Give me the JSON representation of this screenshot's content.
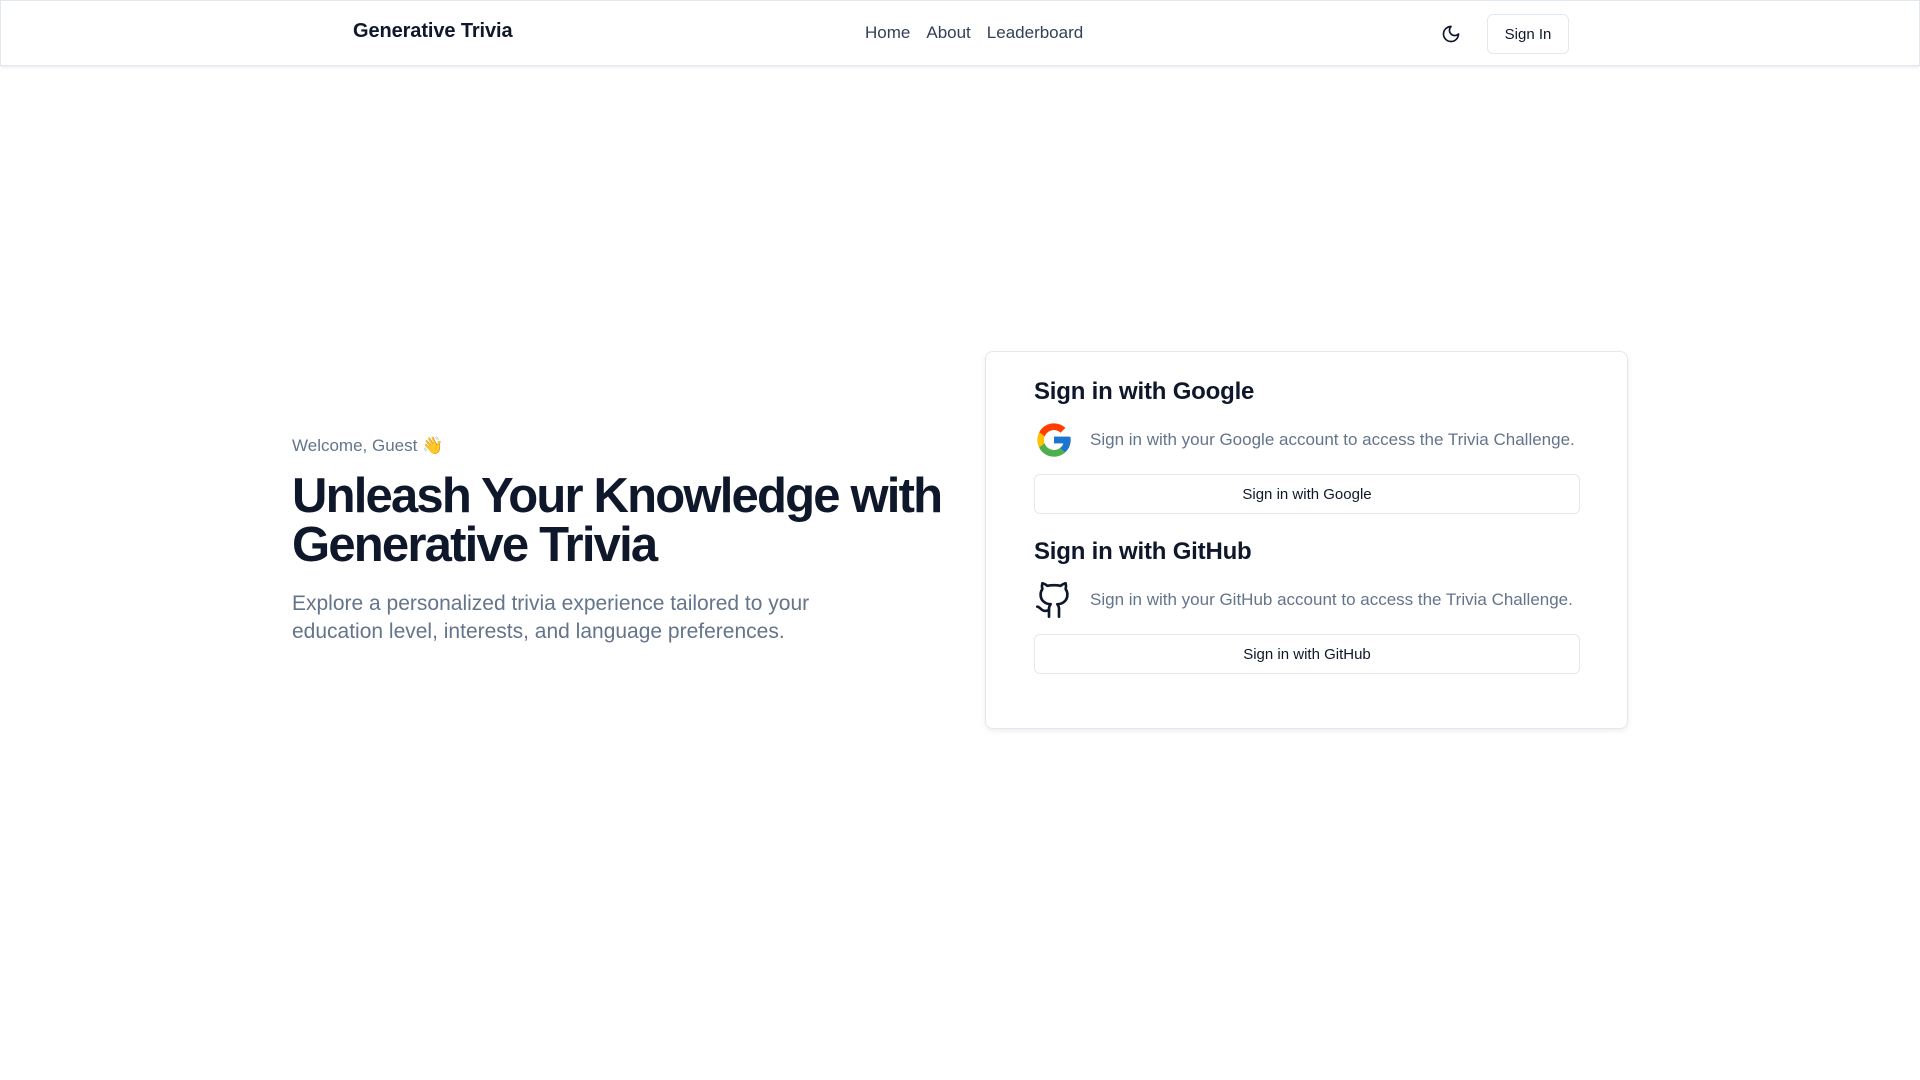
{
  "header": {
    "brand": "Generative Trivia",
    "nav": [
      "Home",
      "About",
      "Leaderboard"
    ],
    "theme_icon": "moon-icon",
    "sign_in_label": "Sign In"
  },
  "hero": {
    "welcome": "Welcome, Guest 👋",
    "headline_line1": "Unleash Your Knowledge with",
    "headline_line2": "Generative Trivia",
    "subtitle": "Explore a personalized trivia experience tailored to your education level, interests, and language preferences."
  },
  "signin_card": {
    "google": {
      "title": "Sign in with Google",
      "icon": "google-icon",
      "description": "Sign in with your Google account to access the Trivia Challenge.",
      "button_label": "Sign in with Google"
    },
    "github": {
      "title": "Sign in with GitHub",
      "icon": "github-icon",
      "description": "Sign in with your GitHub account to access the Trivia Challenge.",
      "button_label": "Sign in with GitHub"
    }
  },
  "colors": {
    "text_primary": "#0f172a",
    "text_muted": "#64748b",
    "border": "#e2e8f0",
    "google_blue": "#4285F4",
    "google_red": "#EA4335",
    "google_yellow": "#FBBC05",
    "google_green": "#34A853"
  }
}
